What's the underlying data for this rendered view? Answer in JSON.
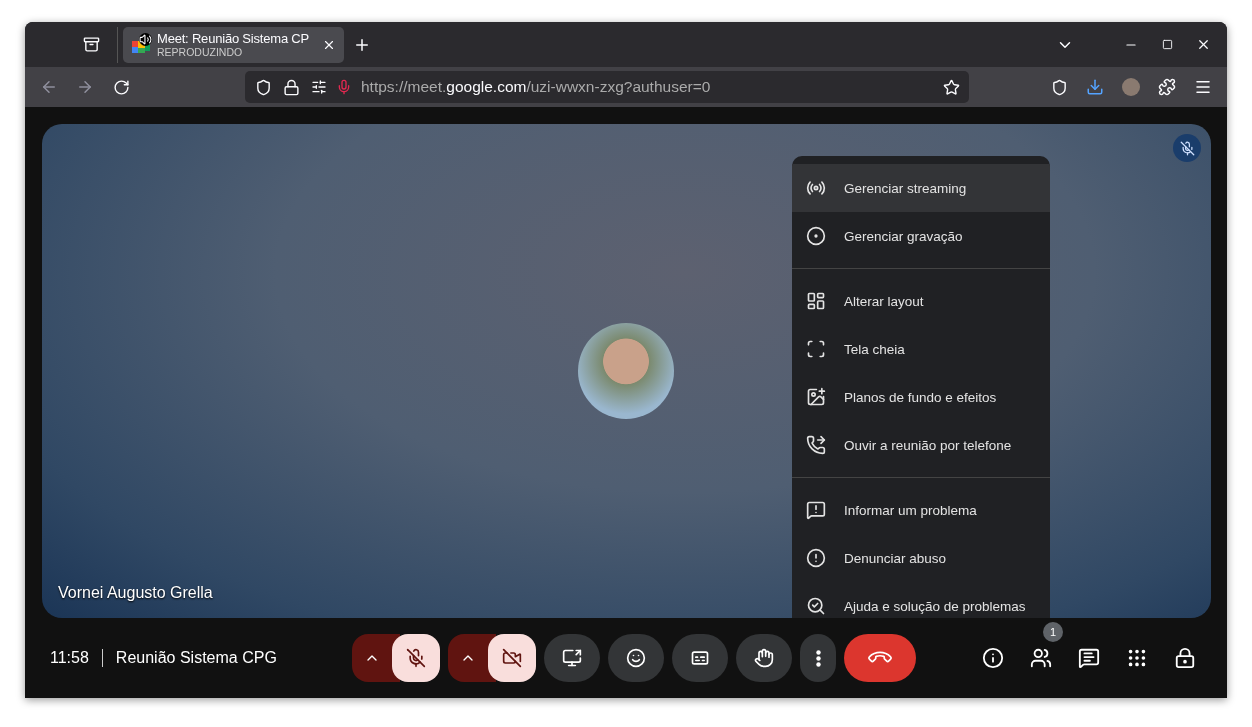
{
  "browser": {
    "tab": {
      "title": "Meet: Reunião Sistema CP",
      "subtitle": "REPRODUZINDO",
      "selected": true,
      "playing": true
    },
    "address": {
      "prefix": "https://meet.",
      "domain": "google.com",
      "path": "/uzi-wwxn-zxg?authuser=0",
      "mic_in_use": true
    }
  },
  "video": {
    "participant": "Vornei Augusto Grella",
    "muted": true
  },
  "menu": {
    "sections": [
      {
        "items": [
          {
            "label": "Gerenciar streaming",
            "selected": true
          },
          {
            "label": "Gerenciar gravação",
            "selected": false
          }
        ]
      },
      {
        "items": [
          {
            "label": "Alterar layout",
            "selected": false
          },
          {
            "label": "Tela cheia",
            "selected": false
          },
          {
            "label": "Planos de fundo e efeitos",
            "selected": false
          },
          {
            "label": "Ouvir a reunião por telefone",
            "selected": false
          }
        ]
      },
      {
        "items": [
          {
            "label": "Informar um problema",
            "selected": false
          },
          {
            "label": "Denunciar abuso",
            "selected": false
          },
          {
            "label": "Ajuda e solução de problemas",
            "selected": false
          }
        ]
      }
    ]
  },
  "footer": {
    "time": "11:58",
    "meeting": "Reunião Sistema CPG",
    "mic_off": true,
    "camera_off": true,
    "participants_count": "1"
  }
}
